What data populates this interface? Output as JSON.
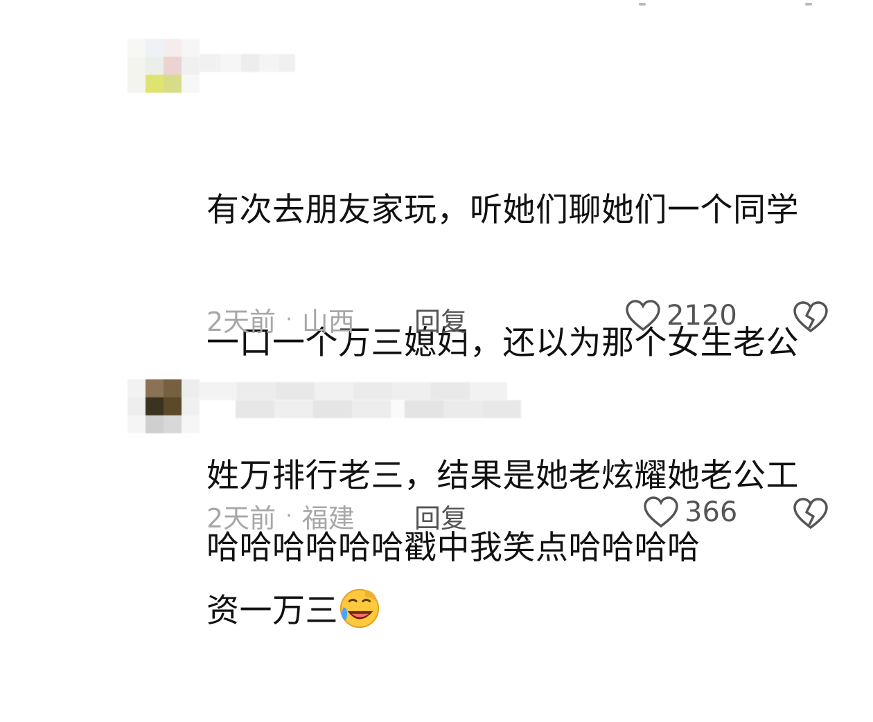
{
  "comments": [
    {
      "text_lines": [
        "有次去朋友家玩，听她们聊她们一个同学",
        "一口一个万三媳妇，还以为那个女生老公",
        "姓万排行老三，结果是她老炫耀她老公工",
        "资一万三"
      ],
      "emoji": "laughing-crying-emoji",
      "time": "2天前",
      "location": "山西",
      "separator": "·",
      "reply_label": "回复",
      "likes": "2120"
    },
    {
      "text_lines": [
        "哈哈哈哈哈哈戳中我笑点哈哈哈哈"
      ],
      "time": "2天前",
      "location": "福建",
      "separator": "·",
      "reply_label": "回复",
      "likes": "366"
    }
  ],
  "colors": {
    "text": "#111111",
    "meta": "#a7a7a7",
    "action": "#555555"
  }
}
